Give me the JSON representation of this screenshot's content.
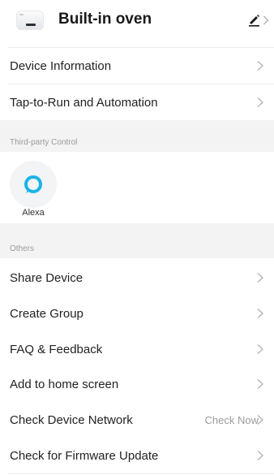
{
  "header": {
    "title": "Built-in oven",
    "device_icon": "oven-thumbnail-icon",
    "edit_icon": "pencil-icon",
    "chevron_icon": "chevron-right-icon"
  },
  "menu_top": [
    {
      "label": "Device Information"
    },
    {
      "label": "Tap-to-Run and Automation"
    }
  ],
  "third_party": {
    "section_title": "Third-party Control",
    "services": [
      {
        "label": "Alexa",
        "icon": "alexa-icon",
        "color": "#1ab4e8"
      }
    ]
  },
  "others": {
    "section_title": "Others",
    "items": [
      {
        "label": "Share Device"
      },
      {
        "label": "Create Group"
      },
      {
        "label": "FAQ & Feedback"
      },
      {
        "label": "Add to home screen"
      },
      {
        "label": "Check Device Network",
        "value": "Check Now"
      },
      {
        "label": "Check for Firmware Update"
      }
    ]
  },
  "colors": {
    "section_background": "#f3f3f3",
    "chevron": "#b0b0b0",
    "alexa_ring": "#1ab4e8"
  }
}
